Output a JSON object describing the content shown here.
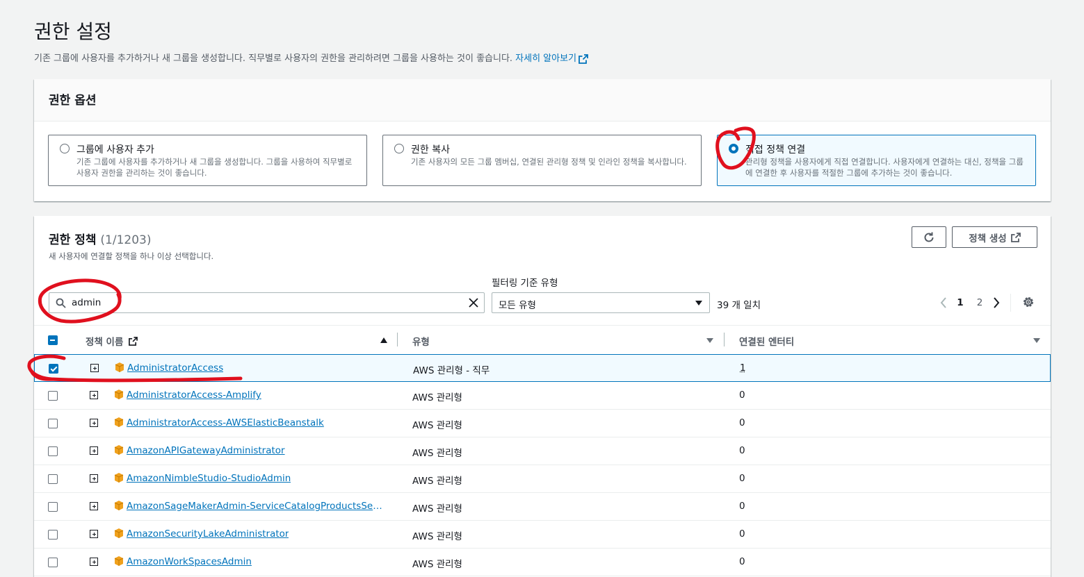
{
  "page": {
    "title": "권한 설정",
    "description": "기존 그룹에 사용자를 추가하거나 새 그룹을 생성합니다. 직무별로 사용자의 권한을 관리하려면 그룹을 사용하는 것이 좋습니다. ",
    "learn_more": "자세히 알아보기"
  },
  "permission_options": {
    "heading": "권한 옵션",
    "options": [
      {
        "title": "그룹에 사용자 추가",
        "description": "기존 그룹에 사용자를 추가하거나 새 그룹을 생성합니다. 그룹을 사용하여 직무별로 사용자 권한을 관리하는 것이 좋습니다.",
        "selected": false
      },
      {
        "title": "권한 복사",
        "description": "기존 사용자의 모든 그룹 멤버십, 연결된 관리형 정책 및 인라인 정책을 복사합니다.",
        "selected": false
      },
      {
        "title": "직접 정책 연결",
        "description": "관리형 정책을 사용자에게 직접 연결합니다. 사용자에게 연결하는 대신, 정책을 그룹에 연결한 후 사용자를 적절한 그룹에 추가하는 것이 좋습니다.",
        "selected": true
      }
    ]
  },
  "policies": {
    "heading": "권한 정책",
    "count": "(1/1203)",
    "description": "새 사용자에 연결할 정책을 하나 이상 선택합니다.",
    "create_button": "정책 생성",
    "search_value": "admin",
    "filter_label": "필터링 기준 유형",
    "filter_value": "모든 유형",
    "match_count": "39 개 일치",
    "pages": [
      "1",
      "2"
    ],
    "current_page": "1",
    "columns": {
      "name": "정책 이름",
      "type": "유형",
      "entities": "연결된 엔터티"
    },
    "rows": [
      {
        "name": "AdministratorAccess",
        "type": "AWS 관리형 - 직무",
        "entities": "1",
        "checked": true
      },
      {
        "name": "AdministratorAccess-Amplify",
        "type": "AWS 관리형",
        "entities": "0",
        "checked": false
      },
      {
        "name": "AdministratorAccess-AWSElasticBeanstalk",
        "type": "AWS 관리형",
        "entities": "0",
        "checked": false
      },
      {
        "name": "AmazonAPIGatewayAdministrator",
        "type": "AWS 관리형",
        "entities": "0",
        "checked": false
      },
      {
        "name": "AmazonNimbleStudio-StudioAdmin",
        "type": "AWS 관리형",
        "entities": "0",
        "checked": false
      },
      {
        "name": "AmazonSageMakerAdmin-ServiceCatalogProductsServiceRolePolicy",
        "type": "AWS 관리형",
        "entities": "0",
        "checked": false
      },
      {
        "name": "AmazonSecurityLakeAdministrator",
        "type": "AWS 관리형",
        "entities": "0",
        "checked": false
      },
      {
        "name": "AmazonWorkSpacesAdmin",
        "type": "AWS 관리형",
        "entities": "0",
        "checked": false
      }
    ]
  },
  "colors": {
    "accent": "#0073bb",
    "annotation": "#e0101e",
    "text": "#16191f",
    "muted": "#687078"
  },
  "icons": {
    "search": "search-icon",
    "clear": "close-icon",
    "refresh": "refresh-icon",
    "external": "external-link-icon",
    "settings": "gear-icon",
    "package": "package-icon"
  }
}
